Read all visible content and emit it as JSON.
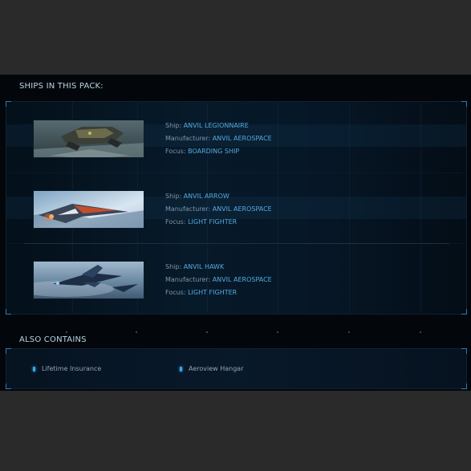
{
  "sections": {
    "ships_title": "SHIPS IN THIS PACK:",
    "contains_title": "ALSO CONTAINS"
  },
  "ships": [
    {
      "ship_label": "Ship:",
      "ship_value": "ANVIL LEGIONNAIRE",
      "manufacturer_label": "Manufacturer:",
      "manufacturer_value": "ANVIL AEROSPACE",
      "focus_label": "Focus:",
      "focus_value": "BOARDING SHIP"
    },
    {
      "ship_label": "Ship:",
      "ship_value": "ANVIL ARROW",
      "manufacturer_label": "Manufacturer:",
      "manufacturer_value": "ANVIL AEROSPACE",
      "focus_label": "Focus:",
      "focus_value": "LIGHT FIGHTER"
    },
    {
      "ship_label": "Ship:",
      "ship_value": "ANVIL HAWK",
      "manufacturer_label": "Manufacturer:",
      "manufacturer_value": "ANVIL AEROSPACE",
      "focus_label": "Focus:",
      "focus_value": "LIGHT FIGHTER"
    }
  ],
  "contains": [
    {
      "label": "Lifetime Insurance"
    },
    {
      "label": "Aeroview Hangar"
    }
  ],
  "colors": {
    "background": "#2b2b2c",
    "panel": "#03070b",
    "accent": "#55a9e0",
    "label": "#7c96ab",
    "title": "#b9d4e6"
  }
}
